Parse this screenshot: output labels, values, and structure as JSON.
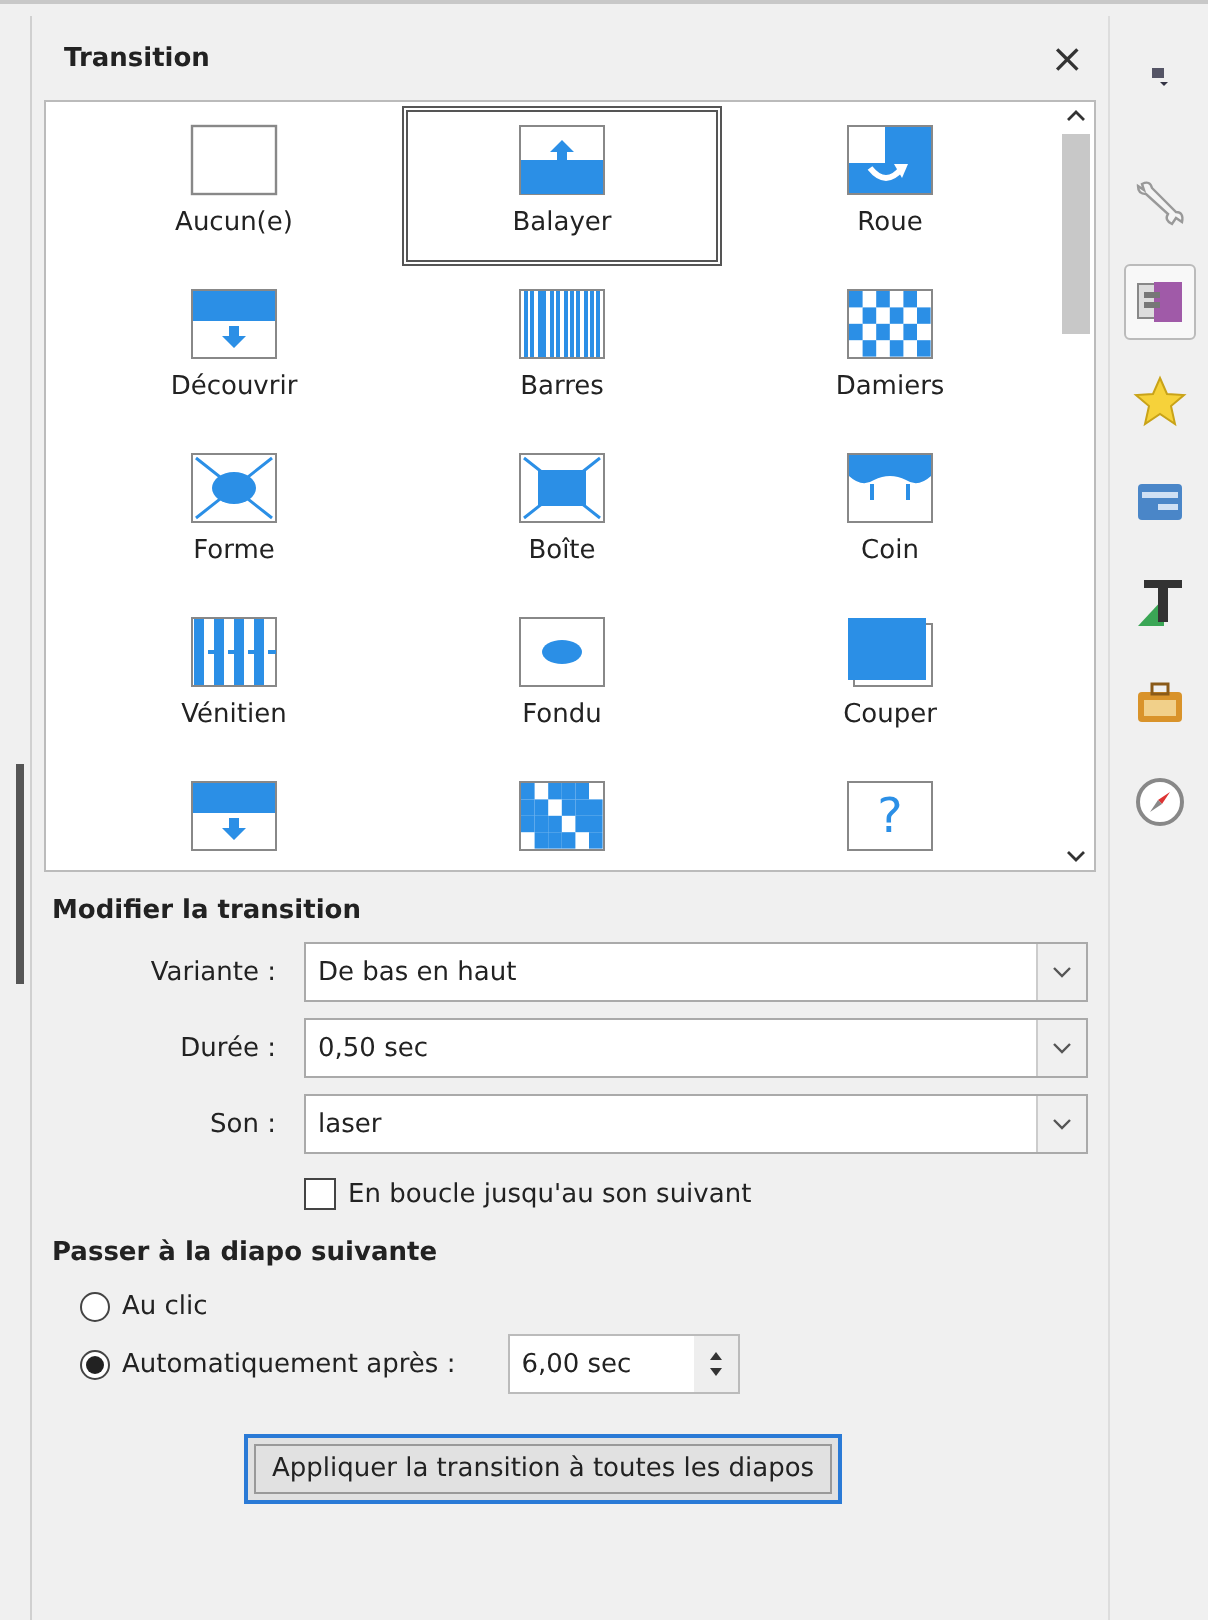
{
  "panel": {
    "title": "Transition",
    "close": "×"
  },
  "transitions": [
    {
      "kind": "none",
      "label": "Aucun(e)",
      "selected": false
    },
    {
      "kind": "wipe",
      "label": "Balayer",
      "selected": true
    },
    {
      "kind": "wheel",
      "label": "Roue",
      "selected": false
    },
    {
      "kind": "uncover",
      "label": "Découvrir",
      "selected": false
    },
    {
      "kind": "bars",
      "label": "Barres",
      "selected": false
    },
    {
      "kind": "checkers",
      "label": "Damiers",
      "selected": false
    },
    {
      "kind": "shape",
      "label": "Forme",
      "selected": false
    },
    {
      "kind": "box",
      "label": "Boîte",
      "selected": false
    },
    {
      "kind": "corner",
      "label": "Coin",
      "selected": false
    },
    {
      "kind": "venetian",
      "label": "Vénitien",
      "selected": false
    },
    {
      "kind": "fade",
      "label": "Fondu",
      "selected": false
    },
    {
      "kind": "cut",
      "label": "Couper",
      "selected": false
    },
    {
      "kind": "push",
      "selected": false
    },
    {
      "kind": "dissolve",
      "selected": false
    },
    {
      "kind": "unknown",
      "glyph": "?",
      "selected": false
    }
  ],
  "modify": {
    "heading": "Modifier la transition",
    "fields": [
      {
        "label": "Variante :",
        "value": "De bas en haut"
      },
      {
        "label": "Durée :",
        "value": "0,50 sec"
      },
      {
        "label": "Son :",
        "value": "laser"
      }
    ],
    "loop": {
      "label": "En boucle jusqu'au son suivant",
      "checked": false
    }
  },
  "advance": {
    "heading": "Passer à la diapo suivante",
    "options": [
      {
        "label": "Au clic",
        "selected": false
      },
      {
        "label": "Automatiquement après :",
        "selected": true
      }
    ],
    "delay": "6,00 sec"
  },
  "apply_button": "Appliquer la transition à toutes les diapos",
  "sidebar": {
    "items": [
      {
        "kind": "properties",
        "selected": false
      },
      {
        "kind": "transition",
        "selected": true
      },
      {
        "kind": "animation",
        "selected": false
      },
      {
        "kind": "layouts",
        "selected": false
      },
      {
        "kind": "styles",
        "selected": false
      },
      {
        "kind": "gallery",
        "selected": false
      },
      {
        "kind": "navigator",
        "selected": false
      }
    ]
  }
}
